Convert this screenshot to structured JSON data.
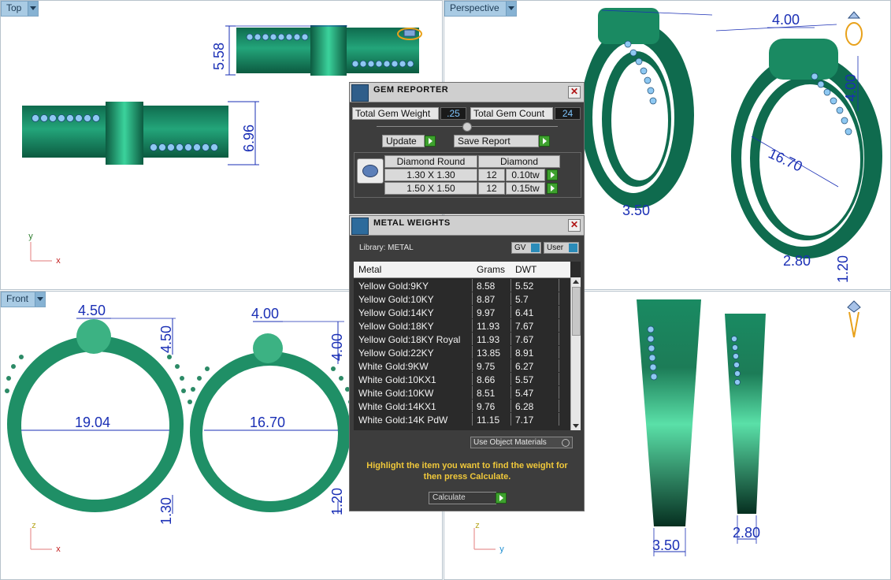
{
  "viewports": {
    "top": {
      "label": "Top",
      "axes": {
        "v": "y",
        "h": "x"
      },
      "dims": [
        "5.58",
        "6.96"
      ]
    },
    "perspective": {
      "label": "Perspective",
      "dims": [
        "4.00",
        "4.00",
        "16.70",
        "3.50",
        "2.80",
        "1.20"
      ]
    },
    "front": {
      "label": "Front",
      "axes": {
        "v": "z",
        "h": "x"
      },
      "dims": [
        "4.50",
        "4.50",
        "19.04",
        "1.30",
        "4.00",
        "4.00",
        "16.70",
        "1.20"
      ]
    },
    "right": {
      "axes": {
        "v": "z",
        "h": "y"
      },
      "dims": [
        "3.50",
        "2.80"
      ]
    }
  },
  "gem_reporter": {
    "title": "GEM REPORTER",
    "total_weight_label": "Total Gem Weight",
    "total_weight_value": ".25",
    "total_count_label": "Total Gem Count",
    "total_count_value": "24",
    "update_label": "Update",
    "save_report_label": "Save Report",
    "group_shape": "Diamond Round",
    "group_material": "Diamond",
    "rows": [
      {
        "size": "1.30 X 1.30",
        "count": "12",
        "weight": "0.10tw"
      },
      {
        "size": "1.50 X 1.50",
        "count": "12",
        "weight": "0.15tw"
      }
    ]
  },
  "metal_weights": {
    "title": "METAL WEIGHTS",
    "library_label": "Library: METAL",
    "gv_label": "GV",
    "user_label": "User",
    "columns": [
      "Metal",
      "Grams",
      "DWT"
    ],
    "rows": [
      {
        "metal": "Yellow Gold:9KY",
        "grams": "8.58",
        "dwt": "5.52"
      },
      {
        "metal": "Yellow Gold:10KY",
        "grams": "8.87",
        "dwt": "5.7"
      },
      {
        "metal": "Yellow Gold:14KY",
        "grams": "9.97",
        "dwt": "6.41"
      },
      {
        "metal": "Yellow Gold:18KY",
        "grams": "11.93",
        "dwt": "7.67"
      },
      {
        "metal": "Yellow Gold:18KY Royal",
        "grams": "11.93",
        "dwt": "7.67"
      },
      {
        "metal": "Yellow Gold:22KY",
        "grams": "13.85",
        "dwt": "8.91"
      },
      {
        "metal": "White Gold:9KW",
        "grams": "9.75",
        "dwt": "6.27"
      },
      {
        "metal": "White Gold:10KX1",
        "grams": "8.66",
        "dwt": "5.57"
      },
      {
        "metal": "White Gold:10KW",
        "grams": "8.51",
        "dwt": "5.47"
      },
      {
        "metal": "White Gold:14KX1",
        "grams": "9.76",
        "dwt": "6.28"
      },
      {
        "metal": "White Gold:14K PdW",
        "grams": "11.15",
        "dwt": "7.17"
      }
    ],
    "use_object_materials_label": "Use Object Materials",
    "hint": "Highlight the item you want to find the weight for then press Calculate.",
    "calculate_label": "Calculate"
  }
}
